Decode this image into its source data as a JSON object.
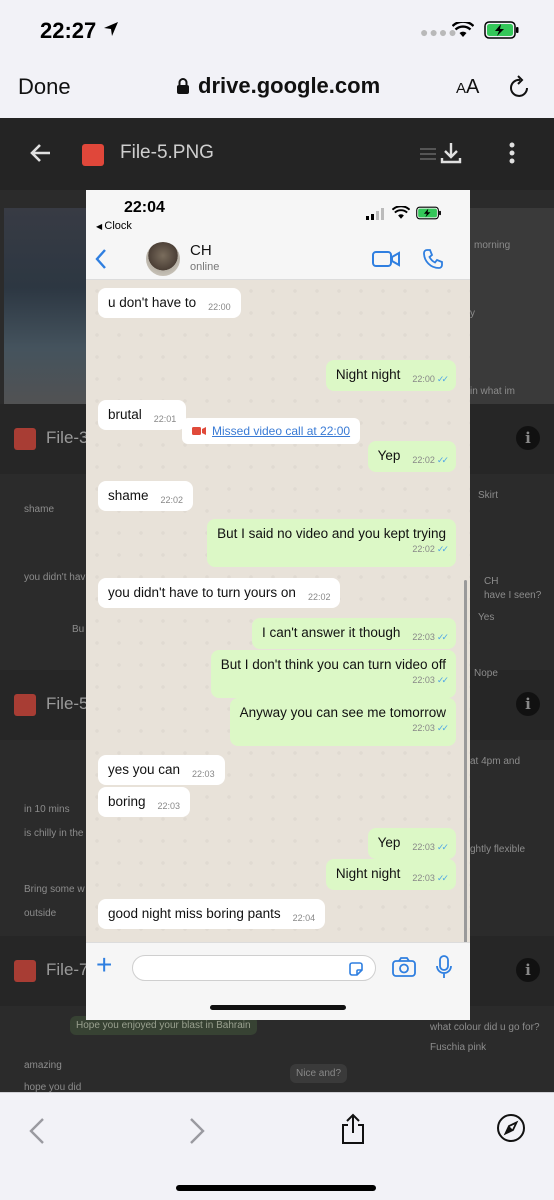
{
  "os_status": {
    "time": "22:27"
  },
  "safari": {
    "done_label": "Done",
    "url": "drive.google.com",
    "text_size_label_big": "A",
    "text_size_label_small": "A"
  },
  "drive": {
    "file_title": "File-5.PNG",
    "bg_files": [
      "File-3",
      "File-5",
      "File-7"
    ],
    "bg_snippets": {
      "s1": "shame",
      "s2": "you didn't hav",
      "s3": "Bu",
      "s4": "in 10 mins",
      "s5": "is chilly in the",
      "s6": "Bring some w",
      "s7": "outside",
      "s8": "Hope you enjoyed your blast in Bahrain",
      "s9": "amazing",
      "s10": "hope you did",
      "s11": "Nice and?",
      "s12": "morning",
      "s13": "in what im",
      "s14": "Skirt",
      "s15": "CH",
      "s16": "have I seen?",
      "s17": "Yes",
      "s18": "Nope",
      "s19": "at 4pm and",
      "s20": "ghtly flexible",
      "s21": "what colour did u go for?",
      "s22": "Fuschia pink",
      "s23": "y"
    }
  },
  "phone": {
    "status_time": "22:04",
    "back_app": "Clock",
    "contact_name": "CH",
    "contact_status": "online",
    "missed_call": "Missed video call at 22:00",
    "messages": [
      {
        "text": "u don't have to",
        "time": "22:00",
        "dir": "in"
      },
      {
        "text": "Night night",
        "time": "22:00",
        "dir": "out"
      },
      {
        "text": "brutal",
        "time": "22:01",
        "dir": "in"
      },
      {
        "text": "Yep",
        "time": "22:02",
        "dir": "out"
      },
      {
        "text": "shame",
        "time": "22:02",
        "dir": "in"
      },
      {
        "text": "But I said no video and you kept trying",
        "time": "22:02",
        "dir": "out"
      },
      {
        "text": "you didn't have to turn yours on",
        "time": "22:02",
        "dir": "in"
      },
      {
        "text": "I can't answer it though",
        "time": "22:03",
        "dir": "out"
      },
      {
        "text": "But I don't think you can turn video off",
        "time": "22:03",
        "dir": "out"
      },
      {
        "text": "Anyway you can see me tomorrow",
        "time": "22:03",
        "dir": "out"
      },
      {
        "text": "yes you can",
        "time": "22:03",
        "dir": "in"
      },
      {
        "text": "boring",
        "time": "22:03",
        "dir": "in"
      },
      {
        "text": "Yep",
        "time": "22:03",
        "dir": "out"
      },
      {
        "text": "Night night",
        "time": "22:03",
        "dir": "out"
      },
      {
        "text": "good night miss boring pants",
        "time": "22:04",
        "dir": "in"
      }
    ],
    "read_tick": "✓✓"
  },
  "colors": {
    "outgoing_bubble": "#dcf8c6",
    "incoming_bubble": "#ffffff",
    "accent_blue": "#2f7fe0",
    "drive_file_red": "#e0473a"
  }
}
